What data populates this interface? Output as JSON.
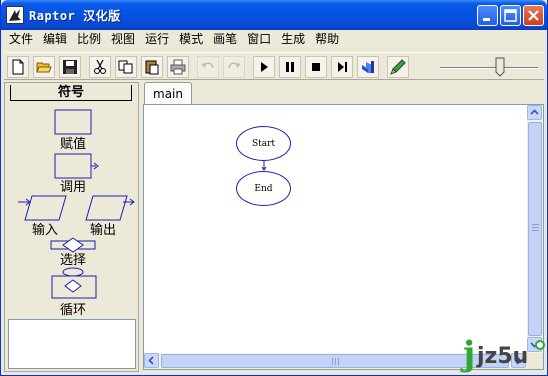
{
  "window": {
    "title": "Raptor 汉化版"
  },
  "menu": [
    "文件",
    "编辑",
    "比例",
    "视图",
    "运行",
    "模式",
    "画笔",
    "窗口",
    "生成",
    "帮助"
  ],
  "toolbar": {
    "buttons": [
      {
        "icon": "new-file-icon"
      },
      {
        "icon": "open-folder-icon"
      },
      {
        "icon": "save-icon"
      },
      {
        "icon": "cut-icon"
      },
      {
        "icon": "copy-icon"
      },
      {
        "icon": "paste-icon"
      },
      {
        "icon": "print-icon"
      },
      {
        "icon": "undo-icon"
      },
      {
        "icon": "redo-icon"
      },
      {
        "icon": "run-icon"
      },
      {
        "icon": "pause-icon"
      },
      {
        "icon": "stop-icon"
      },
      {
        "icon": "step-icon"
      },
      {
        "icon": "test-server-icon"
      },
      {
        "icon": "pen-icon"
      }
    ],
    "speed_level": 0.62
  },
  "symbols": {
    "header": "符号",
    "assignment": "赋值",
    "call": "调用",
    "input": "输入",
    "output": "输出",
    "selection": "选择",
    "loop": "循环"
  },
  "tabs": [
    {
      "label": "main"
    }
  ],
  "flowchart": {
    "start": "Start",
    "end": "End"
  },
  "watermark": {
    "j": "j",
    "text": "jz5u"
  },
  "colors": {
    "titlebar": "#0553e0",
    "shape_stroke": "#1d1db0",
    "watermark_green": "#2fa830"
  }
}
